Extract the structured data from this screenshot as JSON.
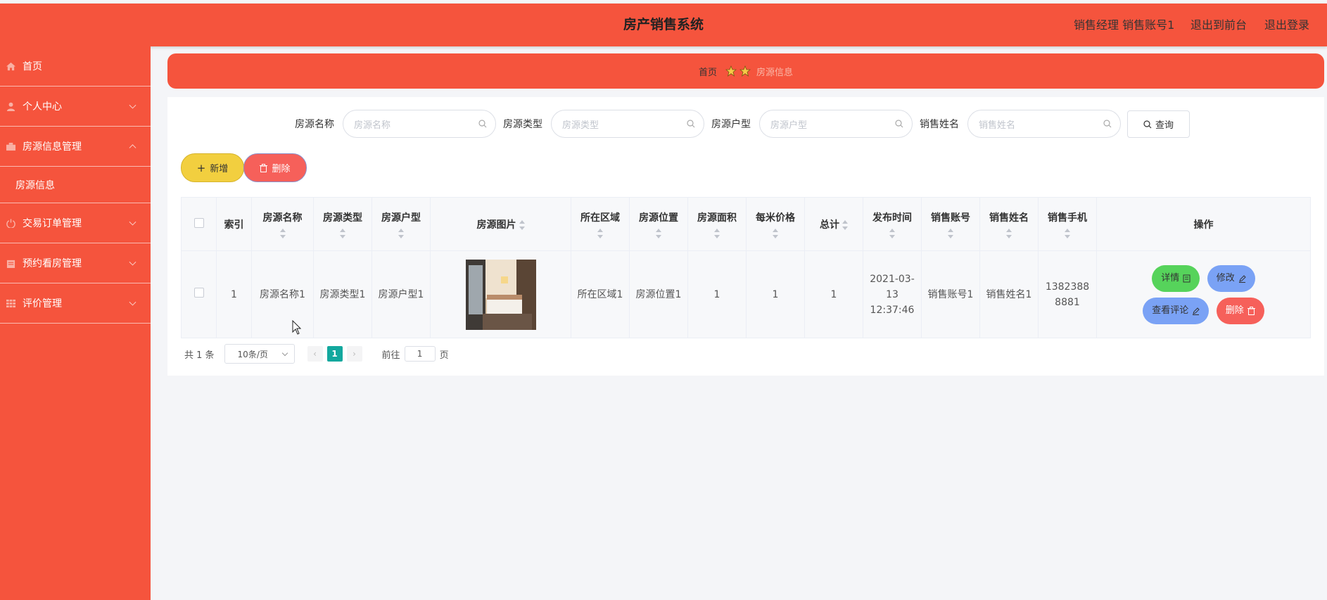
{
  "header": {
    "title": "房产销售系统",
    "user_info": "销售经理 销售账号1",
    "frontend_link": "退出到前台",
    "logout_link": "退出登录"
  },
  "sidebar": {
    "items": [
      {
        "label": "首页",
        "icon": "home-icon"
      },
      {
        "label": "个人中心",
        "icon": "user-icon"
      },
      {
        "label": "房源信息管理",
        "icon": "building-icon",
        "expanded": true,
        "children": [
          {
            "label": "房源信息"
          }
        ]
      },
      {
        "label": "交易订单管理",
        "icon": "power-icon"
      },
      {
        "label": "预约看房管理",
        "icon": "calendar-icon"
      },
      {
        "label": "评价管理",
        "icon": "grid-icon"
      }
    ]
  },
  "breadcrumb": {
    "home": "首页",
    "current": "房源信息"
  },
  "search": {
    "fields": [
      {
        "label": "房源名称",
        "placeholder": "房源名称"
      },
      {
        "label": "房源类型",
        "placeholder": "房源类型"
      },
      {
        "label": "房源户型",
        "placeholder": "房源户型"
      },
      {
        "label": "销售姓名",
        "placeholder": "销售姓名"
      }
    ],
    "query_button": "查询"
  },
  "toolbar": {
    "add_label": "新增",
    "delete_label": "删除"
  },
  "table": {
    "columns": [
      "索引",
      "房源名称",
      "房源类型",
      "房源户型",
      "房源图片",
      "所在区域",
      "房源位置",
      "房源面积",
      "每米价格",
      "总计",
      "发布时间",
      "销售账号",
      "销售姓名",
      "销售手机",
      "操作"
    ],
    "rows": [
      {
        "index": "1",
        "name": "房源名称1",
        "type": "房源类型1",
        "layout": "房源户型1",
        "area_region": "所在区域1",
        "location": "房源位置1",
        "size": "1",
        "price_per_meter": "1",
        "total": "1",
        "publish_time": "2021-03-13 12:37:46",
        "sales_account": "销售账号1",
        "sales_name": "销售姓名1",
        "sales_phone": "13823888881"
      }
    ],
    "actions": {
      "detail": "详情",
      "edit": "修改",
      "comments": "查看评论",
      "delete": "删除"
    }
  },
  "pagination": {
    "total_text": "共 1 条",
    "page_size": "10条/页",
    "current_page": "1",
    "goto_prefix": "前往",
    "goto_value": "1",
    "goto_suffix": "页"
  },
  "colors": {
    "primary": "#f5543d",
    "add": "#f2cf3f",
    "detail": "#56d35b",
    "edit": "#7aa2f5",
    "delete": "#f6605a",
    "page_active": "#13a89e"
  }
}
